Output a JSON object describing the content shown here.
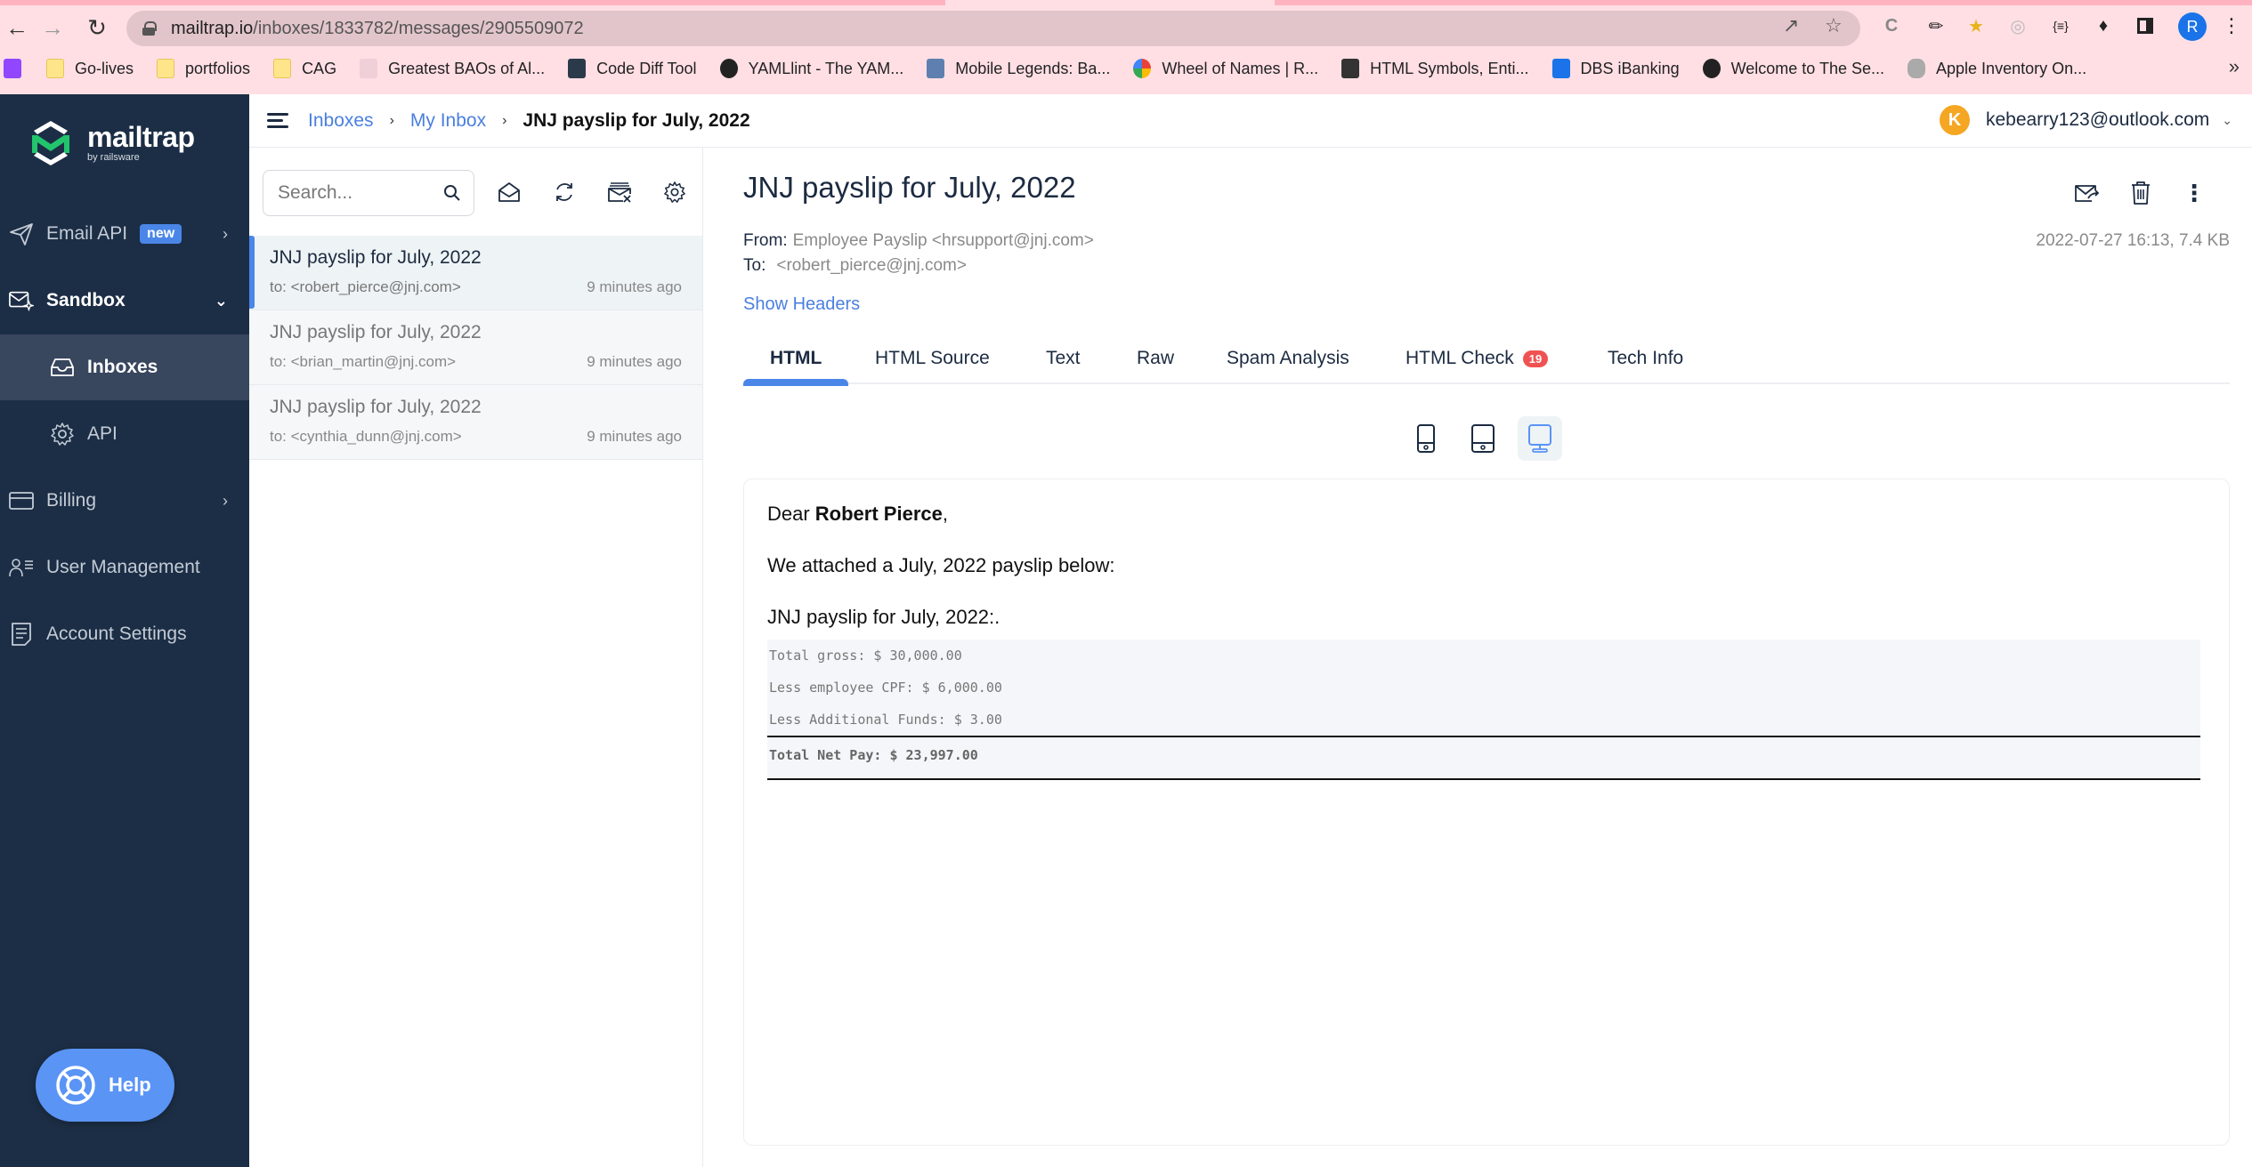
{
  "browser": {
    "url_host": "mailtrap.io",
    "url_path": "/inboxes/1833782/messages/2905509072",
    "bookmarks": [
      {
        "label": "Go-lives",
        "icon": "folder-icon"
      },
      {
        "label": "portfolios",
        "icon": "folder-icon"
      },
      {
        "label": "CAG",
        "icon": "folder-icon"
      },
      {
        "label": "Greatest BAOs of Al...",
        "icon": "site-icon"
      },
      {
        "label": "Code Diff Tool",
        "icon": "w3-icon"
      },
      {
        "label": "YAMLlint - The YAM...",
        "icon": "globe-icon"
      },
      {
        "label": "Mobile Legends: Ba...",
        "icon": "game-icon"
      },
      {
        "label": "Wheel of Names | R...",
        "icon": "wheel-icon"
      },
      {
        "label": "HTML Symbols, Enti...",
        "icon": "ampersand-icon"
      },
      {
        "label": "DBS iBanking",
        "icon": "bank-icon"
      },
      {
        "label": "Welcome to The Se...",
        "icon": "globe-icon"
      },
      {
        "label": "Apple Inventory On...",
        "icon": "apple-icon"
      }
    ],
    "more_bookmarks": "»",
    "profile_initial": "R"
  },
  "sidebar": {
    "logo_name": "mailtrap",
    "logo_sub": "by railsware",
    "items": [
      {
        "label": "Email API",
        "badge": "new",
        "icon": "send-icon"
      },
      {
        "label": "Sandbox",
        "icon": "sandbox-mail-icon"
      },
      {
        "label": "Inboxes",
        "icon": "inbox-icon"
      },
      {
        "label": "API",
        "icon": "gear-icon"
      },
      {
        "label": "Billing",
        "icon": "card-icon"
      },
      {
        "label": "User Management",
        "icon": "users-list-icon"
      },
      {
        "label": "Account Settings",
        "icon": "document-icon"
      }
    ],
    "help_label": "Help"
  },
  "header": {
    "breadcrumbs": [
      "Inboxes",
      "My Inbox",
      "JNJ payslip for July, 2022"
    ],
    "account_initial": "K",
    "account_email": "kebearry123@outlook.com"
  },
  "list": {
    "search_placeholder": "Search...",
    "messages": [
      {
        "subject": "JNJ payslip for July, 2022",
        "to": "to: <robert_pierce@jnj.com>",
        "time": "9 minutes ago",
        "selected": true
      },
      {
        "subject": "JNJ payslip for July, 2022",
        "to": "to: <brian_martin@jnj.com>",
        "time": "9 minutes ago",
        "selected": false
      },
      {
        "subject": "JNJ payslip for July, 2022",
        "to": "to: <cynthia_dunn@jnj.com>",
        "time": "9 minutes ago",
        "selected": false
      }
    ]
  },
  "viewer": {
    "subject": "JNJ payslip for July, 2022",
    "from_label": "From:",
    "from_value": "Employee Payslip <hrsupport@jnj.com>",
    "to_label": "To:",
    "to_value": "<robert_pierce@jnj.com>",
    "show_headers": "Show Headers",
    "meta": "2022-07-27 16:13, 7.4 KB",
    "tabs": [
      {
        "label": "HTML",
        "active": true
      },
      {
        "label": "HTML Source"
      },
      {
        "label": "Text"
      },
      {
        "label": "Raw"
      },
      {
        "label": "Spam Analysis"
      },
      {
        "label": "HTML Check",
        "count": "19"
      },
      {
        "label": "Tech Info"
      }
    ],
    "active_device": "desktop"
  },
  "email": {
    "greeting_prefix": "Dear ",
    "recipient_name": "Robert Pierce",
    "greeting_suffix": ",",
    "line1": "We attached a July, 2022 payslip below:",
    "line2": "JNJ payslip for July, 2022:.",
    "payslip": {
      "gross": "Total gross: $ 30,000.00",
      "cpf": "Less employee CPF: $ 6,000.00",
      "additional": "Less Additional Funds: $ 3.00",
      "net": "Total Net Pay: $ 23,997.00"
    }
  },
  "colors": {
    "sidebar_bg": "#1c2e45",
    "accent": "#4a86e8",
    "badge_red": "#f05252",
    "chrome_pink": "#ffdfe4"
  }
}
